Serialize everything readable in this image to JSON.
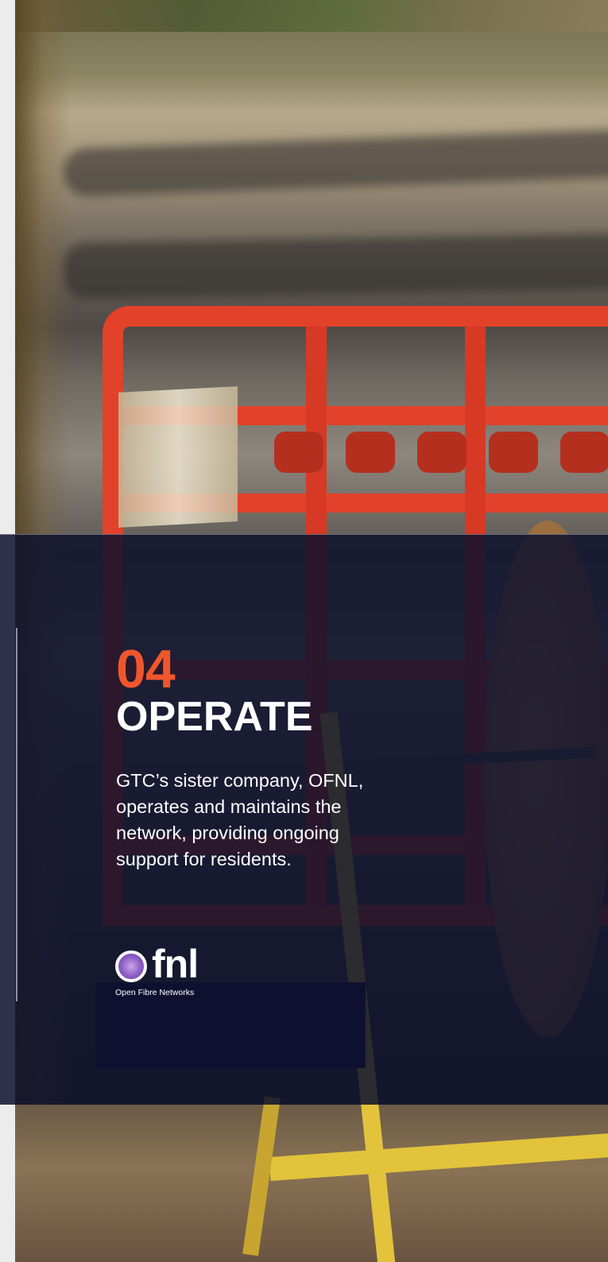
{
  "section": {
    "number": "04",
    "title": "OPERATE",
    "description": "GTC’s sister company, OFNL, operates and maintains the network, providing ongoing support for residents."
  },
  "logo": {
    "wordmark": "fnl",
    "subtitle": "Open Fibre Networks"
  },
  "colors": {
    "accent": "#f0562d",
    "overlay": "#0e112d",
    "text": "#ffffff"
  }
}
